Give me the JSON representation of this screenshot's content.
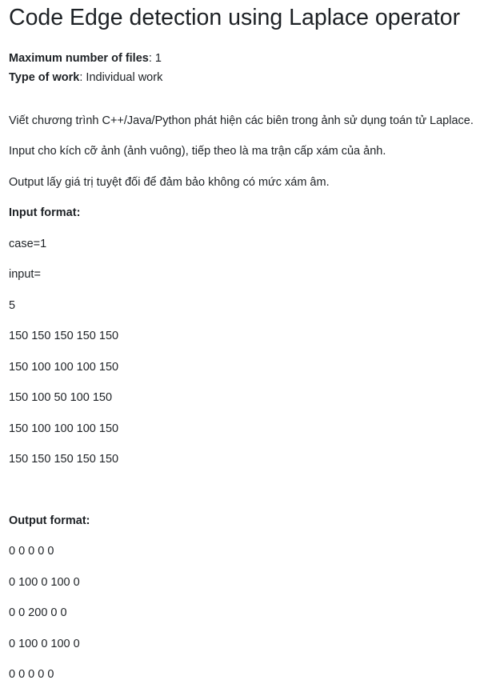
{
  "title": "Code Edge detection using Laplace operator",
  "meta": {
    "max_files_label": "Maximum number of files",
    "max_files_value": "1",
    "work_type_label": "Type of work",
    "work_type_value": "Individual work"
  },
  "description": [
    "Viết chương trình C++/Java/Python phát hiện các biên trong ảnh sử dụng toán tử Laplace.",
    "Input cho kích cỡ ảnh (ảnh vuông), tiếp theo là ma trận cấp xám của ảnh.",
    "Output lấy giá trị tuyệt đối để đảm bảo không có mức xám âm."
  ],
  "input_format": {
    "heading": "Input format:",
    "lines": [
      "case=1",
      "input=",
      "5",
      "150 150 150 150 150",
      "150 100 100 100 150",
      "150 100 50 100 150",
      "150 100 100 100 150",
      "150 150 150 150 150"
    ]
  },
  "output_format": {
    "heading": "Output format:",
    "lines": [
      "0 0 0 0 0",
      "0 100 0 100 0",
      "0 0 200 0 0",
      "0 100 0 100 0",
      "0 0 0 0 0"
    ]
  }
}
